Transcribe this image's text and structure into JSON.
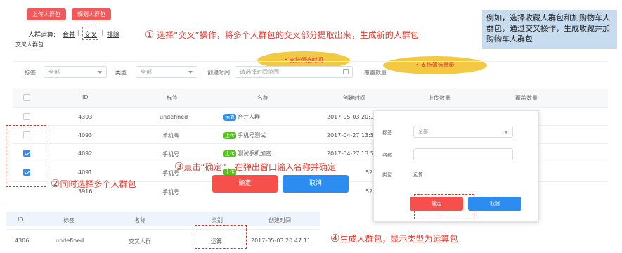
{
  "top_buttons": {
    "upload": "上传人群包",
    "rule": "规则人群包"
  },
  "ops": {
    "label": "人群运算:",
    "merge": "合并",
    "intersect": "交叉",
    "exclude": "排除",
    "intersect_pkg": "交叉人群包"
  },
  "annotations": {
    "a1_num": "①",
    "a1_text": "选择“交叉”操作，将多个人群包的交叉部分提取出来，生成新的人群包",
    "a2_num": "②",
    "a2_text": "同时选择多个人群包",
    "a3_num": "③",
    "a3_text": "点击“确定”，在弹出窗口输入名称并确定",
    "a4_num": "④",
    "a4_text": "生成人群包，显示类型为运算包"
  },
  "note_box": "例如，选择收藏人群包和加购物车人群包，通过交叉操作，生成收藏并加购物车人群包",
  "bubbles": {
    "time": "支持筛选时间",
    "count": "支持筛选量级"
  },
  "filters": {
    "tag_label": "标签",
    "tag_value": "全部",
    "type_label": "类型",
    "type_value": "全部",
    "time_label": "创建时间",
    "time_placeholder": "请选择时间范围",
    "count_label": "覆盖数量"
  },
  "table": {
    "headers": {
      "id": "ID",
      "tag": "标签",
      "name": "名称",
      "created": "创建时间",
      "upload_count": "上传数量",
      "coverage": "覆盖数量"
    },
    "rows": [
      {
        "id": "4303",
        "tag": "undefined",
        "badge": "运算",
        "name": "合并人群",
        "created": "2017-05-03 20:12",
        "checked": false
      },
      {
        "id": "4093",
        "tag": "手机号",
        "badge": "上传",
        "name": "手机号测试",
        "created": "2017-04-27 13:56",
        "checked": false
      },
      {
        "id": "4092",
        "tag": "手机号",
        "badge": "上传",
        "name": "测试手机加密",
        "created": "2017-04-27 13:55",
        "checked": true
      },
      {
        "id": "4091",
        "tag": "手机号",
        "badge": "上传",
        "name": "",
        "created": "",
        "checked": true
      },
      {
        "id": "3916",
        "tag": "手机号",
        "badge": "",
        "name": "",
        "created": "",
        "checked": false
      }
    ],
    "partial_counts": [
      "52",
      "52"
    ]
  },
  "main_buttons": {
    "confirm": "确定",
    "cancel": "取消"
  },
  "dialog": {
    "tag_label": "标签",
    "tag_value": "全部",
    "name_label": "名称",
    "name_value": "",
    "type_label": "类型",
    "type_value": "运算",
    "confirm": "确定",
    "cancel": "取消"
  },
  "result_table": {
    "headers": {
      "id": "ID",
      "tag": "标签",
      "name": "名称",
      "type": "类别",
      "created": "创建时间"
    },
    "row": {
      "id": "4306",
      "tag": "undefined",
      "name": "交叉人群",
      "type": "运算",
      "created": "2017-05-03 20:47:11"
    }
  },
  "colors": {
    "accent_red": "#f05a5a",
    "blue": "#2d8cf0",
    "badge_green": "#52c41a",
    "badge_blue": "#2d8cf0",
    "note_bg": "#c8dcf0"
  }
}
